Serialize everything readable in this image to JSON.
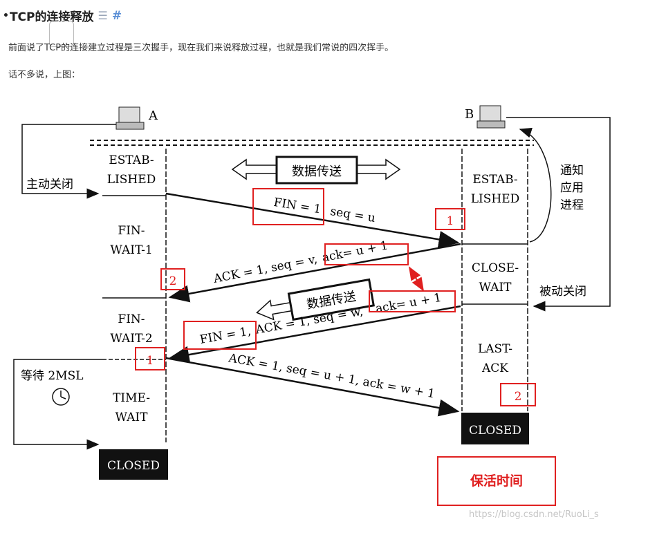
{
  "header": {
    "title": "TCP的连接释放",
    "bullet": "•",
    "list_icon": "☰",
    "anchor_icon": "#"
  },
  "intro": "前面说了TCP的连接建立过程是三次握手，现在我们来说释放过程，也就是我们常说的四次挥手。",
  "intro2": "话不多说，上图：",
  "diagram": {
    "host_a": "A",
    "host_b": "B",
    "a_states": [
      "ESTAB-",
      "LISHED",
      "FIN-",
      "WAIT-1",
      "FIN-",
      "WAIT-2",
      "TIME-",
      "WAIT"
    ],
    "a_closed": "CLOSED",
    "b_states": [
      "ESTAB-",
      "LISHED",
      "CLOSE-",
      "WAIT",
      "LAST-",
      "ACK"
    ],
    "b_closed": "CLOSED",
    "active_close": "主动关闭",
    "passive_close": "被动关闭",
    "notify_app": [
      "通知",
      "应用",
      "进程"
    ],
    "data_transfer": "数据传送",
    "msg1_fin": "FIN = 1",
    "msg1_seq": "seq = u",
    "msg2_ack": "ACK = 1, seq = v,",
    "msg2_ackno": "ack= u + 1",
    "msg3_fin": "FIN = 1,",
    "msg3_rest": "ACK = 1, seq = w,",
    "msg3_ackno": "ack= u + 1",
    "msg4": "ACK = 1, seq = u + 1, ack = w + 1",
    "wait_2msl": "等待 2MSL",
    "label_1": "1",
    "label_2": "2",
    "keepalive": "保活时间"
  },
  "watermark": "https://blog.csdn.net/RuoLi_s",
  "colors": {
    "annotation_red": "#e02020",
    "anchor_blue": "#5b8fd6"
  }
}
